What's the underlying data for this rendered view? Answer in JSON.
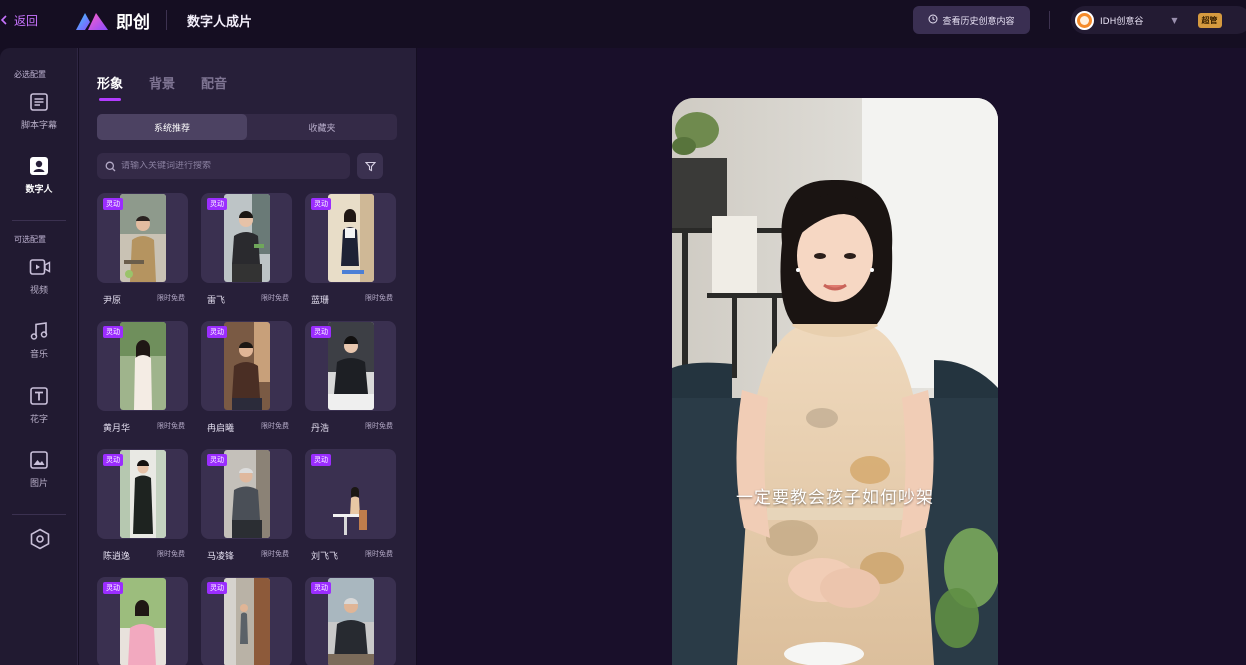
{
  "header": {
    "back_label": "返回",
    "brand_name": "即创",
    "page_title": "数字人成片",
    "history_button": "查看历史创意内容",
    "account_name": "IDH创意谷",
    "vip_label": "超管",
    "colors": {
      "accent": "#b23cff",
      "background": "#150e22"
    }
  },
  "rail": {
    "required_label": "必选配置",
    "optional_label": "可选配置",
    "items": [
      {
        "label": "脚本字幕",
        "icon": "script-icon"
      },
      {
        "label": "数字人",
        "icon": "avatar-icon",
        "active": true
      },
      {
        "label": "视频",
        "icon": "video-icon"
      },
      {
        "label": "音乐",
        "icon": "music-icon"
      },
      {
        "label": "花字",
        "icon": "text-icon"
      },
      {
        "label": "图片",
        "icon": "image-icon"
      },
      {
        "label": "",
        "icon": "settings-hex-icon"
      }
    ]
  },
  "panel": {
    "tabs": [
      {
        "label": "形象",
        "active": true
      },
      {
        "label": "背景"
      },
      {
        "label": "配音"
      }
    ],
    "segments": [
      {
        "label": "系统推荐",
        "active": true
      },
      {
        "label": "收藏夹"
      }
    ],
    "search": {
      "placeholder": "请输入关键词进行搜索",
      "value": ""
    },
    "badge_label": "灵动",
    "cards": [
      {
        "name": "尹原",
        "tag": "限时免费"
      },
      {
        "name": "雷飞",
        "tag": "限时免费"
      },
      {
        "name": "蓝珊",
        "tag": "限时免费"
      },
      {
        "name": "黄月华",
        "tag": "限时免费"
      },
      {
        "name": "冉启曦",
        "tag": "限时免费"
      },
      {
        "name": "丹浩",
        "tag": "限时免费"
      },
      {
        "name": "陈逍逸",
        "tag": "限时免费"
      },
      {
        "name": "马凌锋",
        "tag": "限时免费"
      },
      {
        "name": "刘飞飞",
        "tag": "限时免费"
      },
      {
        "name": "",
        "tag": ""
      },
      {
        "name": "",
        "tag": ""
      },
      {
        "name": "",
        "tag": ""
      }
    ]
  },
  "preview": {
    "subtitle": "一定要教会孩子如何吵架"
  }
}
